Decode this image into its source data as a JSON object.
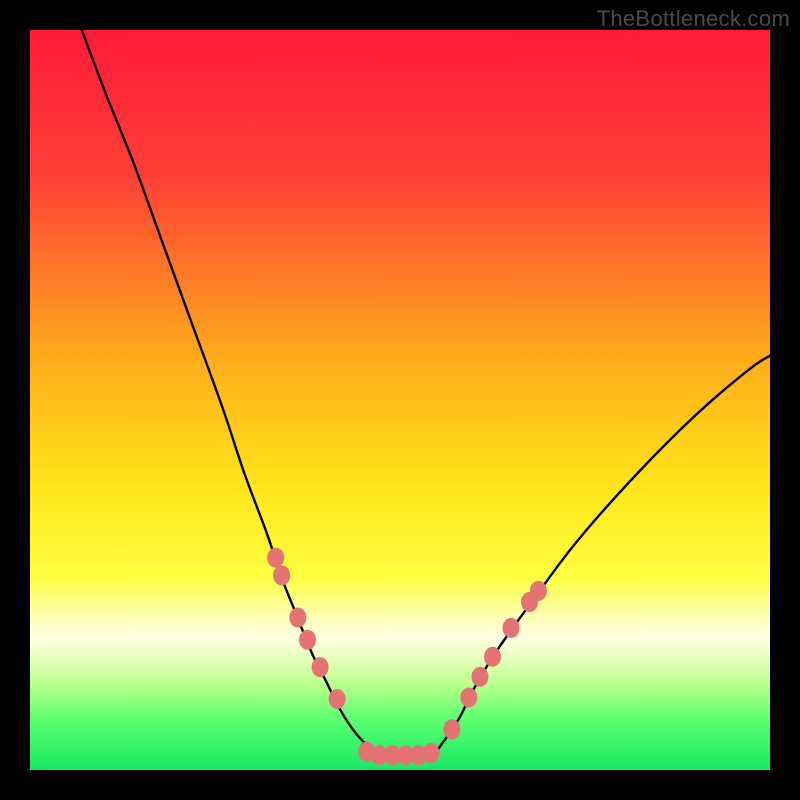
{
  "watermark": "TheBottleneck.com",
  "chart_data": {
    "type": "line",
    "title": "",
    "xlabel": "",
    "ylabel": "",
    "xlim": [
      0,
      100
    ],
    "ylim": [
      0,
      100
    ],
    "series": [
      {
        "name": "left-curve",
        "x": [
          7,
          10,
          14,
          18,
          22,
          26,
          29,
          32,
          34,
          36,
          38,
          40,
          42,
          44,
          46,
          48,
          50
        ],
        "y": [
          100,
          92,
          82,
          71,
          60,
          49,
          40,
          32,
          26,
          21,
          16,
          12,
          8,
          5,
          3,
          2,
          2
        ]
      },
      {
        "name": "right-curve",
        "x": [
          50,
          54,
          56,
          58,
          60,
          63,
          68,
          74,
          82,
          90,
          97,
          100
        ],
        "y": [
          2,
          2,
          4,
          7,
          11,
          16,
          23,
          31,
          40,
          48,
          54,
          56
        ]
      }
    ],
    "markers": [
      {
        "x": 33.2,
        "y": 28.7
      },
      {
        "x": 34.0,
        "y": 26.3
      },
      {
        "x": 36.2,
        "y": 20.6
      },
      {
        "x": 37.5,
        "y": 17.6
      },
      {
        "x": 39.2,
        "y": 13.9
      },
      {
        "x": 41.5,
        "y": 9.6
      },
      {
        "x": 45.5,
        "y": 2.5
      },
      {
        "x": 47.2,
        "y": 2.0
      },
      {
        "x": 49.0,
        "y": 2.0
      },
      {
        "x": 50.8,
        "y": 2.0
      },
      {
        "x": 52.5,
        "y": 2.0
      },
      {
        "x": 54.2,
        "y": 2.3
      },
      {
        "x": 57.0,
        "y": 5.5
      },
      {
        "x": 59.3,
        "y": 9.8
      },
      {
        "x": 60.8,
        "y": 12.6
      },
      {
        "x": 62.5,
        "y": 15.3
      },
      {
        "x": 65.0,
        "y": 19.2
      },
      {
        "x": 67.5,
        "y": 22.7
      },
      {
        "x": 68.7,
        "y": 24.2
      }
    ],
    "gradient_stops": [
      {
        "offset": 0,
        "color": "#ff1a3a"
      },
      {
        "offset": 20,
        "color": "#ff4036"
      },
      {
        "offset": 45,
        "color": "#ffae1a"
      },
      {
        "offset": 62,
        "color": "#ffe61a"
      },
      {
        "offset": 74,
        "color": "#ffff40"
      },
      {
        "offset": 79,
        "color": "#ffffb0"
      },
      {
        "offset": 82,
        "color": "#fdffe0"
      },
      {
        "offset": 84,
        "color": "#f0ffc8"
      },
      {
        "offset": 88,
        "color": "#c0ff90"
      },
      {
        "offset": 93,
        "color": "#5eff70"
      },
      {
        "offset": 100,
        "color": "#17e864"
      }
    ],
    "marker_color": "#e57373",
    "curve_color": "#000000"
  }
}
